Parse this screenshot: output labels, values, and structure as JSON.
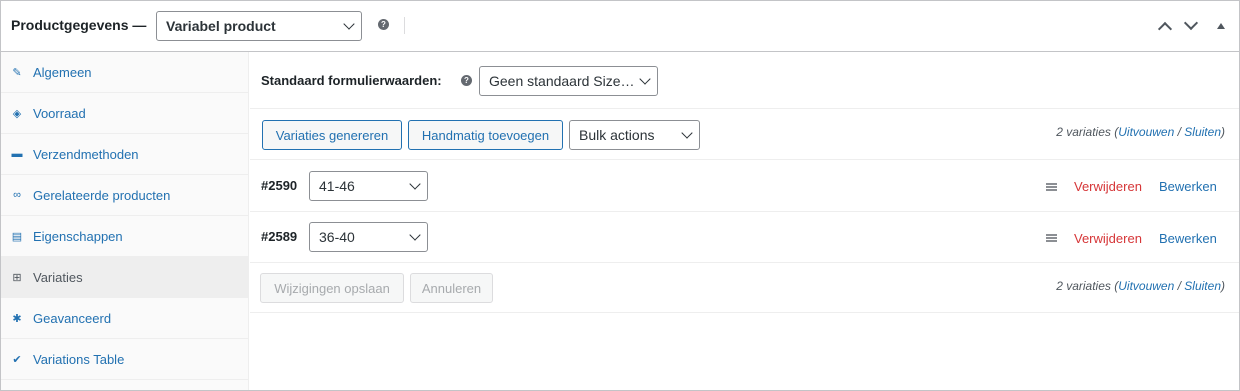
{
  "header": {
    "title": "Productgegevens —",
    "product_type": "Variabel product",
    "help": "?"
  },
  "sidebar": {
    "items": [
      {
        "label": "Algemeen",
        "icon": "wrench-icon",
        "glyph": "✎"
      },
      {
        "label": "Voorraad",
        "icon": "tag-icon",
        "glyph": "◈"
      },
      {
        "label": "Verzendmethoden",
        "icon": "truck-icon",
        "glyph": "▬"
      },
      {
        "label": "Gerelateerde producten",
        "icon": "link-icon",
        "glyph": "∞"
      },
      {
        "label": "Eigenschappen",
        "icon": "list-icon",
        "glyph": "▤"
      },
      {
        "label": "Variaties",
        "icon": "grid-icon",
        "glyph": "⊞"
      },
      {
        "label": "Geavanceerd",
        "icon": "gear-icon",
        "glyph": "✱"
      },
      {
        "label": "Variations Table",
        "icon": "check-circle-icon",
        "glyph": "✔"
      }
    ]
  },
  "defaults": {
    "label": "Standaard formulierwaarden:",
    "select_value": "Geen standaard Size…"
  },
  "toolbar": {
    "generate": "Variaties genereren",
    "add_manual": "Handmatig toevoegen",
    "bulk": "Bulk actions"
  },
  "count": {
    "text": "2 variaties",
    "open_paren": "(",
    "expand": "Uitvouwen",
    "sep": " / ",
    "close": "Sluiten",
    "close_paren": ")"
  },
  "variations": [
    {
      "id": "#2590",
      "value": "41-46"
    },
    {
      "id": "#2589",
      "value": "36-40"
    }
  ],
  "actions": {
    "remove": "Verwijderen",
    "edit": "Bewerken"
  },
  "footer": {
    "save": "Wijzigingen opslaan",
    "cancel": "Annuleren"
  }
}
